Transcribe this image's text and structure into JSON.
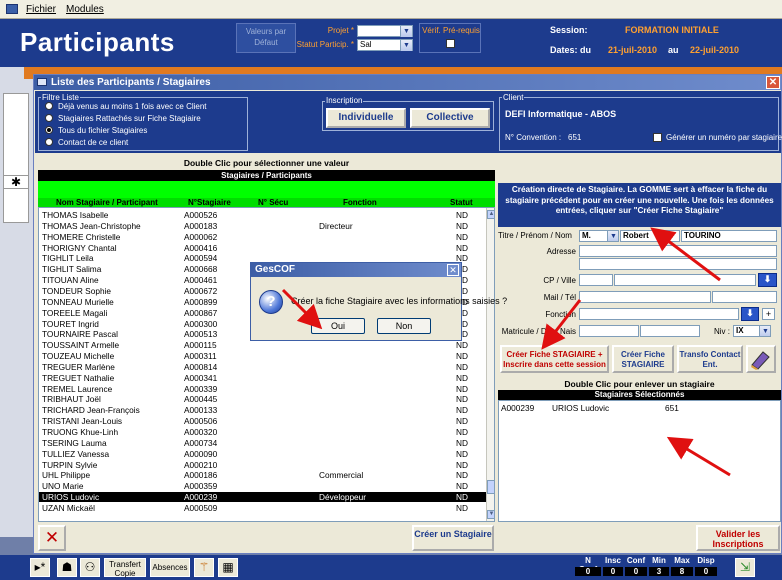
{
  "menu": {
    "items": [
      "Fichier",
      "Modules"
    ]
  },
  "header": {
    "title": "Participants",
    "valeurs_label_1": "Valeurs par",
    "valeurs_label_2": "Défaut",
    "projet_label": "Projet *",
    "statut_label": "Statut Particip. *",
    "statut_value": "Sal",
    "verif_label": "Vérif. Pré-requis",
    "session_label": "Session:",
    "session_value": "FORMATION INITIALE",
    "dates_label": "Dates: du",
    "date_from": "21-juil-2010",
    "au_label": "au",
    "date_to": "22-juil-2010"
  },
  "window": {
    "title": "Liste des Participants / Stagiaires",
    "filter": {
      "title": "Filtre Liste",
      "options": [
        {
          "label": "Déjà venus au moins 1 fois avec ce Client",
          "selected": false
        },
        {
          "label": "Stagiaires Rattachés sur Fiche Stagiaire",
          "selected": false
        },
        {
          "label": "Tous du fichier Stagiaires",
          "selected": true
        },
        {
          "label": "Contact de ce client",
          "selected": false
        }
      ]
    },
    "inscription": {
      "title": "Inscription",
      "individuelle": "Individuelle",
      "collective": "Collective"
    },
    "client": {
      "title": "Client",
      "name": "DEFI Informatique - ABOS",
      "convention_label": "N° Convention :",
      "convention_value": "651",
      "generer_label": "Générer un numéro par stagiaire"
    },
    "list": {
      "hint": "Double Clic pour sélectionner une valeur",
      "header": "Stagiaires / Participants",
      "columns": [
        "Nom Stagiaire / Participant",
        "N°Stagiaire",
        "N° Sécu",
        "Fonction",
        "Statut"
      ],
      "rows": [
        [
          "THOMAS Isabelle",
          "A000526",
          "",
          "",
          "ND"
        ],
        [
          "THOMAS Jean-Christophe",
          "A000183",
          "",
          "Directeur",
          "ND"
        ],
        [
          "THOMERE Christelle",
          "A000062",
          "",
          "",
          "ND"
        ],
        [
          "THORIGNY Chantal",
          "A000416",
          "",
          "",
          "ND"
        ],
        [
          "TIGHLIT Leila",
          "A000594",
          "",
          "",
          "ND"
        ],
        [
          "TIGHLIT Salima",
          "A000668",
          "",
          "",
          "ND"
        ],
        [
          "TITOUAN Aline",
          "A000461",
          "",
          "",
          "ND"
        ],
        [
          "TONDEUR Sophie",
          "A000672",
          "",
          "",
          "ND"
        ],
        [
          "TONNEAU Murielle",
          "A000899",
          "",
          "",
          "ND"
        ],
        [
          "TOREELE Magali",
          "A000867",
          "",
          "",
          "ND"
        ],
        [
          "TOURET Ingrid",
          "A000300",
          "",
          "",
          "ND"
        ],
        [
          "TOURNAIRE Pascal",
          "A000513",
          "",
          "",
          "ND"
        ],
        [
          "TOUSSAINT Armelle",
          "A000115",
          "",
          "",
          "ND"
        ],
        [
          "TOUZEAU Michelle",
          "A000311",
          "",
          "",
          "ND"
        ],
        [
          "TREGUER Marlène",
          "A000814",
          "",
          "",
          "ND"
        ],
        [
          "TREGUET Nathalie",
          "A000341",
          "",
          "",
          "ND"
        ],
        [
          "TREMEL Laurence",
          "A000339",
          "",
          "",
          "ND"
        ],
        [
          "TRIBHAUT Joël",
          "A000445",
          "",
          "",
          "ND"
        ],
        [
          "TRICHARD Jean-François",
          "A000133",
          "",
          "",
          "ND"
        ],
        [
          "TRISTANI Jean-Louis",
          "A000506",
          "",
          "",
          "ND"
        ],
        [
          "TRUONG Khue-Linh",
          "A000320",
          "",
          "",
          "ND"
        ],
        [
          "TSERING Lauma",
          "A000734",
          "",
          "",
          "ND"
        ],
        [
          "TULLIEZ Vanessa",
          "A000090",
          "",
          "",
          "ND"
        ],
        [
          "TURPIN Sylvie",
          "A000210",
          "",
          "",
          "ND"
        ],
        [
          "UHL Philippe",
          "A000186",
          "",
          "Commercial",
          "ND"
        ],
        [
          "UNO Marie",
          "A000359",
          "",
          "",
          "ND"
        ],
        [
          "URIOS Ludovic",
          "A000239",
          "",
          "Développeur",
          "ND"
        ],
        [
          "UZAN Mickaël",
          "A000509",
          "",
          "",
          "ND"
        ]
      ],
      "selected_index": 26
    },
    "right": {
      "note": "Création directe de Stagiaire. La GOMME sert à effacer la fiche du stagiaire précédent pour en créer une nouvelle. Une fois les données entrées, cliquer sur \"Créer Fiche Stagiaire\"",
      "titre_label": "Titre / Prénom / Nom",
      "titre_value": "M.",
      "prenom_value": "Robert",
      "nom_value": "TOURINO",
      "adresse_label": "Adresse",
      "cp_label": "CP / Ville",
      "mail_label": "Mail / Tél",
      "fonction_label": "Fonction",
      "matricule_label": "Matricule / Date Nais",
      "niv_label": "Niv :",
      "niv_value": "IX",
      "btn_creer_inscrire": "Créer Fiche STAGIAIRE + Inscrire dans cette session",
      "btn_creer_fiche": "Créer Fiche STAGIAIRE",
      "btn_transfo": "Transfo Contact Ent.",
      "remove_hint": "Double Clic pour enlever un stagiaire",
      "selected_header": "Stagiaires Sélectionnés",
      "selected_rows": [
        [
          "A000239",
          "URIOS Ludovic",
          "651"
        ]
      ]
    },
    "footer": {
      "creer_stagiaire": "Créer un Stagiaire",
      "valider": "Valider les Inscriptions"
    }
  },
  "dialog": {
    "title": "GesCOF",
    "message": "Créer la fiche Stagiaire avec les informations saisies ?",
    "oui": "Oui",
    "non": "Non"
  },
  "bottombar": {
    "transfert": "Transfert Copie",
    "absences": "Absences",
    "stats_headers": [
      "N Conf",
      "Insc",
      "Conf",
      "Min",
      "Max",
      "Disp"
    ],
    "stats_values": [
      "0",
      "0",
      "0",
      "3",
      "8",
      "0"
    ]
  },
  "colors": {
    "navy": "#1d3b8d",
    "orange": "#ffa030",
    "green": "#00ff00",
    "arrow": "#e01010"
  }
}
